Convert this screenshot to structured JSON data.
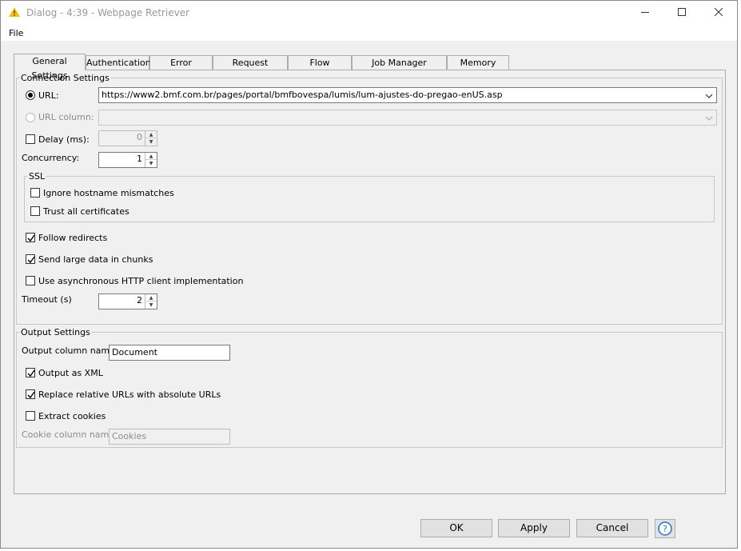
{
  "window": {
    "title": "Dialog - 4:39 - Webpage Retriever",
    "minimize_icon": "minimize-icon",
    "maximize_icon": "maximize-icon",
    "close_icon": "close-icon",
    "app_icon": "knime-warning-triangle-icon",
    "icon_color": "#f5c400"
  },
  "menu": {
    "file": "File"
  },
  "tabs": [
    {
      "label": "General Settings",
      "active": true
    },
    {
      "label": "Authentication"
    },
    {
      "label": "Error Handling"
    },
    {
      "label": "Request Headers"
    },
    {
      "label": "Flow Variables"
    },
    {
      "label": "Job Manager Selection"
    },
    {
      "label": "Memory Policy"
    }
  ],
  "connection": {
    "legend": "Connection Settings",
    "url_label": "URL:",
    "url_selected": true,
    "url_value": "https://www2.bmf.com.br/pages/portal/bmfbovespa/lumis/lum-ajustes-do-pregao-enUS.asp",
    "url_column_label": "URL column:",
    "url_column_value": "",
    "delay_label": "Delay (ms):",
    "delay_checked": false,
    "delay_value": "0",
    "concurrency_label": "Concurrency:",
    "concurrency_value": "1",
    "ssl": {
      "legend": "SSL",
      "ignore_hostname_label": "Ignore hostname mismatches",
      "ignore_hostname_checked": false,
      "trust_all_label": "Trust all certificates",
      "trust_all_checked": false
    },
    "follow_redirects_label": "Follow redirects",
    "follow_redirects_checked": true,
    "send_chunks_label": "Send large data in chunks",
    "send_chunks_checked": true,
    "async_label": "Use asynchronous HTTP client implementation",
    "async_checked": false,
    "timeout_label": "Timeout (s)",
    "timeout_value": "2"
  },
  "output": {
    "legend": "Output Settings",
    "column_name_label": "Output column name",
    "column_name_value": "Document",
    "output_xml_label": "Output as XML",
    "output_xml_checked": true,
    "replace_urls_label": "Replace relative URLs with absolute URLs",
    "replace_urls_checked": true,
    "extract_cookies_label": "Extract cookies",
    "extract_cookies_checked": false,
    "cookie_column_label": "Cookie column name",
    "cookie_column_value": "Cookies"
  },
  "buttons": {
    "ok": "OK",
    "apply": "Apply",
    "cancel": "Cancel",
    "help_icon": "help-question-icon",
    "help_color": "#1e73d6"
  }
}
